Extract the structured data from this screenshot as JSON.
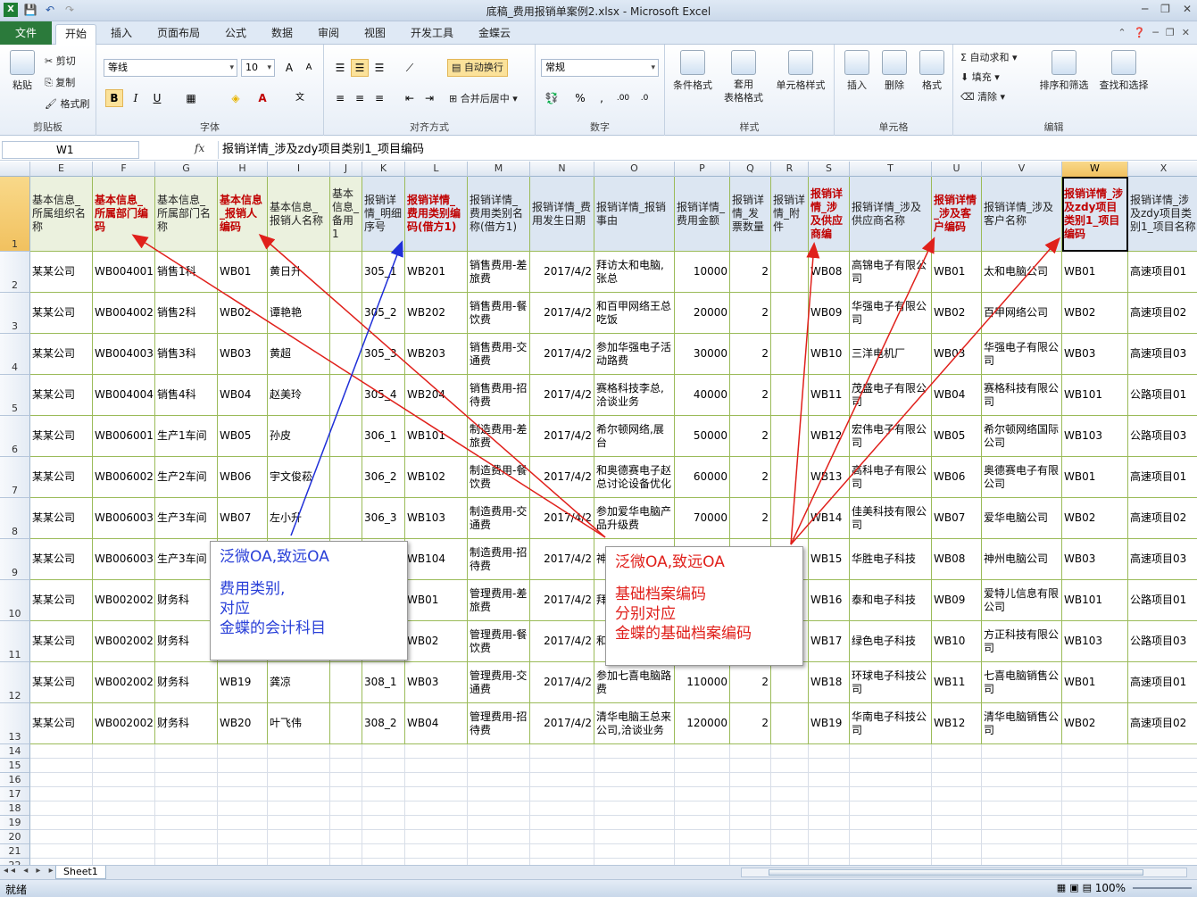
{
  "window": {
    "title": "底稿_费用报销单案例2.xlsx  -  Microsoft Excel"
  },
  "qat": {
    "save": "💾",
    "undo": "↶",
    "redo": "↷"
  },
  "tabs": [
    "文件",
    "开始",
    "插入",
    "页面布局",
    "公式",
    "数据",
    "审阅",
    "视图",
    "开发工具",
    "金蝶云"
  ],
  "ribbon": {
    "clipboard": {
      "label": "剪贴板",
      "paste": "粘贴",
      "cut": "剪切",
      "copy": "复制",
      "format_painter": "格式刷"
    },
    "font": {
      "label": "字体",
      "name": "等线",
      "size": "10",
      "bold": "B",
      "italic": "I",
      "underline": "U"
    },
    "align": {
      "label": "对齐方式",
      "wrap": "自动换行",
      "merge": "合并后居中"
    },
    "number": {
      "label": "数字",
      "format": "常规"
    },
    "styles": {
      "label": "样式",
      "cond": "条件格式",
      "table": "套用\n表格格式",
      "cell": "单元格样式"
    },
    "cells": {
      "label": "单元格",
      "insert": "插入",
      "delete": "删除",
      "format": "格式"
    },
    "editing": {
      "label": "编辑",
      "autosum": "自动求和",
      "fill": "填充",
      "clear": "清除",
      "sort": "排序和筛选",
      "find": "查找和选择"
    }
  },
  "formula_bar": {
    "name_box": "W1",
    "fx": "fx",
    "formula": "报销详情_涉及zdy项目类别1_项目编码"
  },
  "columns": [
    "E",
    "F",
    "G",
    "H",
    "I",
    "J",
    "K",
    "L",
    "M",
    "N",
    "O",
    "P",
    "Q",
    "R",
    "S",
    "T",
    "U",
    "V",
    "W",
    "X"
  ],
  "header_row": [
    "基本信息_所属组织名称",
    "基本信息_所属部门编码",
    "基本信息_所属部门名称",
    "基本信息_报销人编码",
    "基本信息_报销人名称",
    "基本信息_备用1",
    "报销详情_明细序号",
    "报销详情_费用类别编码(借方1)",
    "报销详情_费用类别名称(借方1)",
    "报销详情_费用发生日期",
    "报销详情_报销事由",
    "报销详情_费用金额",
    "报销详情_发票数量",
    "报销详情_附件",
    "报销详情_涉及供应商编",
    "报销详情_涉及供应商名称",
    "报销详情_涉及客户编码",
    "报销详情_涉及客户名称",
    "报销详情_涉及zdy项目类别1_项目编码",
    "报销详情_涉及zdy项目类别1_项目名称"
  ],
  "rows": [
    [
      "某某公司",
      "WB004001",
      "销售1科",
      "WB01",
      "黄日升",
      "",
      "305_1",
      "WB201",
      "销售费用-差旅费",
      "2017/4/2",
      "拜访太和电脑,张总",
      "10000",
      "2",
      "",
      "WB08",
      "高锦电子有限公司",
      "WB01",
      "太和电脑公司",
      "WB01",
      "高速项目01"
    ],
    [
      "某某公司",
      "WB004002",
      "销售2科",
      "WB02",
      "谭艳艳",
      "",
      "305_2",
      "WB202",
      "销售费用-餐饮费",
      "2017/4/2",
      "和百甲网络王总吃饭",
      "20000",
      "2",
      "",
      "WB09",
      "华强电子有限公司",
      "WB02",
      "百甲网络公司",
      "WB02",
      "高速项目02"
    ],
    [
      "某某公司",
      "WB004003",
      "销售3科",
      "WB03",
      "黄超",
      "",
      "305_3",
      "WB203",
      "销售费用-交通费",
      "2017/4/2",
      "参加华强电子活动路费",
      "30000",
      "2",
      "",
      "WB10",
      "三洋电机厂",
      "WB03",
      "华强电子有限公司",
      "WB03",
      "高速项目03"
    ],
    [
      "某某公司",
      "WB004004",
      "销售4科",
      "WB04",
      "赵美玲",
      "",
      "305_4",
      "WB204",
      "销售费用-招待费",
      "2017/4/2",
      "赛格科技李总,洽谈业务",
      "40000",
      "2",
      "",
      "WB11",
      "茂盛电子有限公司",
      "WB04",
      "赛格科技有限公司",
      "WB101",
      "公路项目01"
    ],
    [
      "某某公司",
      "WB006001",
      "生产1车间",
      "WB05",
      "孙皮",
      "",
      "306_1",
      "WB101",
      "制造费用-差旅费",
      "2017/4/2",
      "希尔顿网络,展台",
      "50000",
      "2",
      "",
      "WB12",
      "宏伟电子有限公司",
      "WB05",
      "希尔顿网络国际公司",
      "WB103",
      "公路项目03"
    ],
    [
      "某某公司",
      "WB006002",
      "生产2车间",
      "WB06",
      "宇文俊菘",
      "",
      "306_2",
      "WB102",
      "制造费用-餐饮费",
      "2017/4/2",
      "和奥德赛电子赵总讨论设备优化",
      "60000",
      "2",
      "",
      "WB13",
      "高科电子有限公司",
      "WB06",
      "奥德赛电子有限公司",
      "WB01",
      "高速项目01"
    ],
    [
      "某某公司",
      "WB006003",
      "生产3车间",
      "WB07",
      "左小升",
      "",
      "306_3",
      "WB103",
      "制造费用-交通费",
      "2017/4/2",
      "参加爱华电脑产品升级费",
      "70000",
      "2",
      "",
      "WB14",
      "佳美科技有限公司",
      "WB07",
      "爱华电脑公司",
      "WB02",
      "高速项目02"
    ],
    [
      "某某公司",
      "WB006003",
      "生产3车间",
      "",
      "",
      "",
      "",
      "WB104",
      "制造费用-招待费",
      "2017/4/2",
      "神州电脑周总来",
      "",
      "",
      "",
      "WB15",
      "华胜电子科技",
      "WB08",
      "神州电脑公司",
      "WB03",
      "高速项目03"
    ],
    [
      "某某公司",
      "WB002002",
      "财务科",
      "",
      "",
      "",
      "",
      "WB01",
      "管理费用-差旅费",
      "2017/4/2",
      "拜",
      "",
      "",
      "",
      "WB16",
      "泰和电子科技",
      "WB09",
      "爱特儿信息有限公司",
      "WB101",
      "公路项目01"
    ],
    [
      "某某公司",
      "WB002002",
      "财务科",
      "",
      "",
      "",
      "",
      "WB02",
      "管理费用-餐饮费",
      "2017/4/2",
      "和",
      "",
      "",
      "",
      "WB17",
      "绿色电子科技",
      "WB10",
      "方正科技有限公司",
      "WB103",
      "公路项目03"
    ],
    [
      "某某公司",
      "WB002002",
      "财务科",
      "WB19",
      "龚凉",
      "",
      "308_1",
      "WB03",
      "管理费用-交通费",
      "2017/4/2",
      "参加七喜电脑路费",
      "110000",
      "2",
      "",
      "WB18",
      "环球电子科技公司",
      "WB11",
      "七喜电脑销售公司",
      "WB01",
      "高速项目01"
    ],
    [
      "某某公司",
      "WB002002",
      "财务科",
      "WB20",
      "叶飞伟",
      "",
      "308_2",
      "WB04",
      "管理费用-招待费",
      "2017/4/2",
      "清华电脑王总来公司,洽谈业务",
      "120000",
      "2",
      "",
      "WB19",
      "华南电子科技公司",
      "WB12",
      "清华电脑销售公司",
      "WB02",
      "高速项目02"
    ]
  ],
  "empty_rows": [
    "14",
    "15",
    "16",
    "17",
    "18",
    "19",
    "20",
    "21",
    "22"
  ],
  "callouts": {
    "left": {
      "title": "泛微OA,致远OA",
      "lines": [
        "费用类别,",
        "对应",
        "金蝶的会计科目"
      ]
    },
    "right": {
      "title": "泛微OA,致远OA",
      "lines": [
        "基础档案编码",
        "分别对应",
        "金蝶的基础档案编码"
      ]
    }
  },
  "sheet": {
    "tab": "Sheet1"
  },
  "status": {
    "ready": "就绪",
    "zoom": "100%"
  },
  "colors": {
    "red_header": "#c00000",
    "arrow_red": "#e0201b",
    "arrow_blue": "#1f2fd8",
    "grid_line": "#9bbb59"
  }
}
